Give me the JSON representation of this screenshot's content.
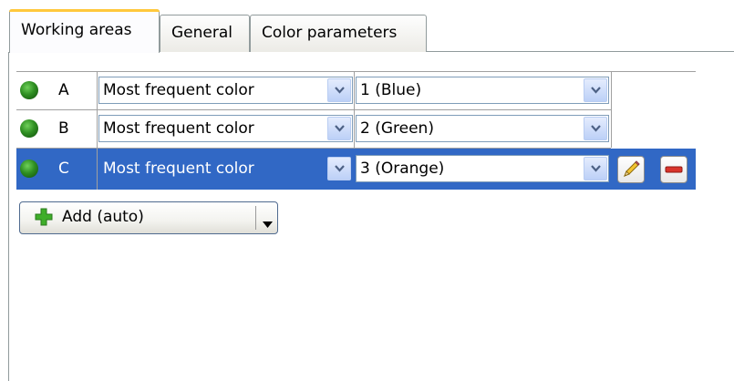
{
  "tabs": [
    {
      "label": "Working areas",
      "active": true
    },
    {
      "label": "General",
      "active": false
    },
    {
      "label": "Color parameters",
      "active": false
    }
  ],
  "areas": [
    {
      "letter": "A",
      "mode": "Most frequent color",
      "color": "1 (Blue)",
      "selected": false
    },
    {
      "letter": "B",
      "mode": "Most frequent color",
      "color": "2 (Green)",
      "selected": false
    },
    {
      "letter": "C",
      "mode": "Most frequent color",
      "color": "3 (Orange)",
      "selected": true
    }
  ],
  "add_button": {
    "label": "Add (auto)"
  },
  "colors": {
    "selection": "#3168c5",
    "tab_accent": "#ffc83c",
    "status_led": "#2f8f22"
  },
  "icons": [
    "status-led-icon",
    "chevron-down-icon",
    "pencil-icon",
    "minus-icon",
    "plus-icon",
    "dropdown-arrow-icon"
  ]
}
